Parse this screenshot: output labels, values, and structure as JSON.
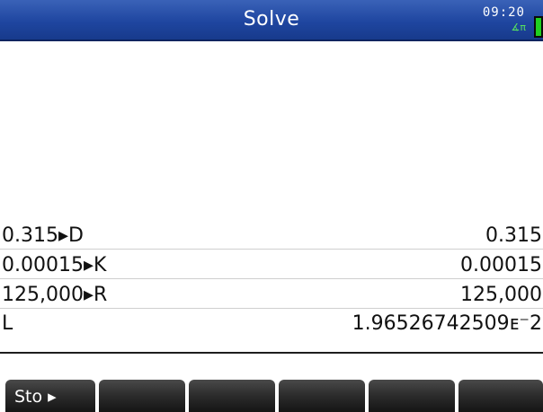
{
  "app": {
    "title": "Solve",
    "clock": "09:20",
    "angle_mode_indicator": "∡π",
    "battery_icon": "battery-icon"
  },
  "history": [
    {
      "input": "0.315▸D",
      "output": "0.315"
    },
    {
      "input": "0.00015▸K",
      "output": "0.00015"
    },
    {
      "input": "125,000▸R",
      "output": "125,000"
    },
    {
      "input": "L",
      "output": "1.96526742509ᴇ⁻2"
    }
  ],
  "command_line": {
    "value": ""
  },
  "menu": {
    "keys": [
      "Sto ▸",
      "",
      "",
      "",
      "",
      ""
    ]
  },
  "colors": {
    "title_bar": "#1f46a0",
    "menu_key": "#2b2b2b",
    "battery": "#20d020"
  }
}
